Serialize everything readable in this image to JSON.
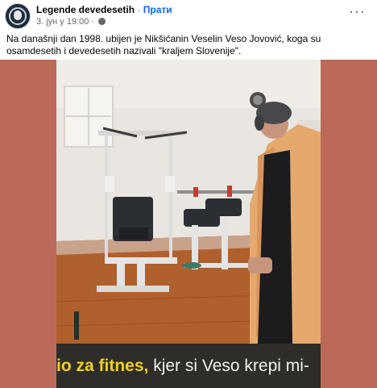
{
  "post": {
    "page_name": "Legende devedesetih",
    "separator": "·",
    "follow_label": "Прати",
    "timestamp": "3. јун у 19:00",
    "meta_separator": "·",
    "privacy_icon": "globe-icon",
    "more_icon": "more-options-icon",
    "text": "Na današnji dan 1998. ubijen je Nikšićanin Veselin Veso Jovović, koga su osamdesetih i devedesetih nazivali \"kraljem Slovenije\"."
  },
  "photo": {
    "caption_highlight": "io za fitnes,",
    "caption_rest": " kjer si Veso krepi mi-"
  },
  "colors": {
    "accent": "#0866ff",
    "backdrop": "#bb6a5a",
    "caption_highlight": "#f2d11a"
  }
}
